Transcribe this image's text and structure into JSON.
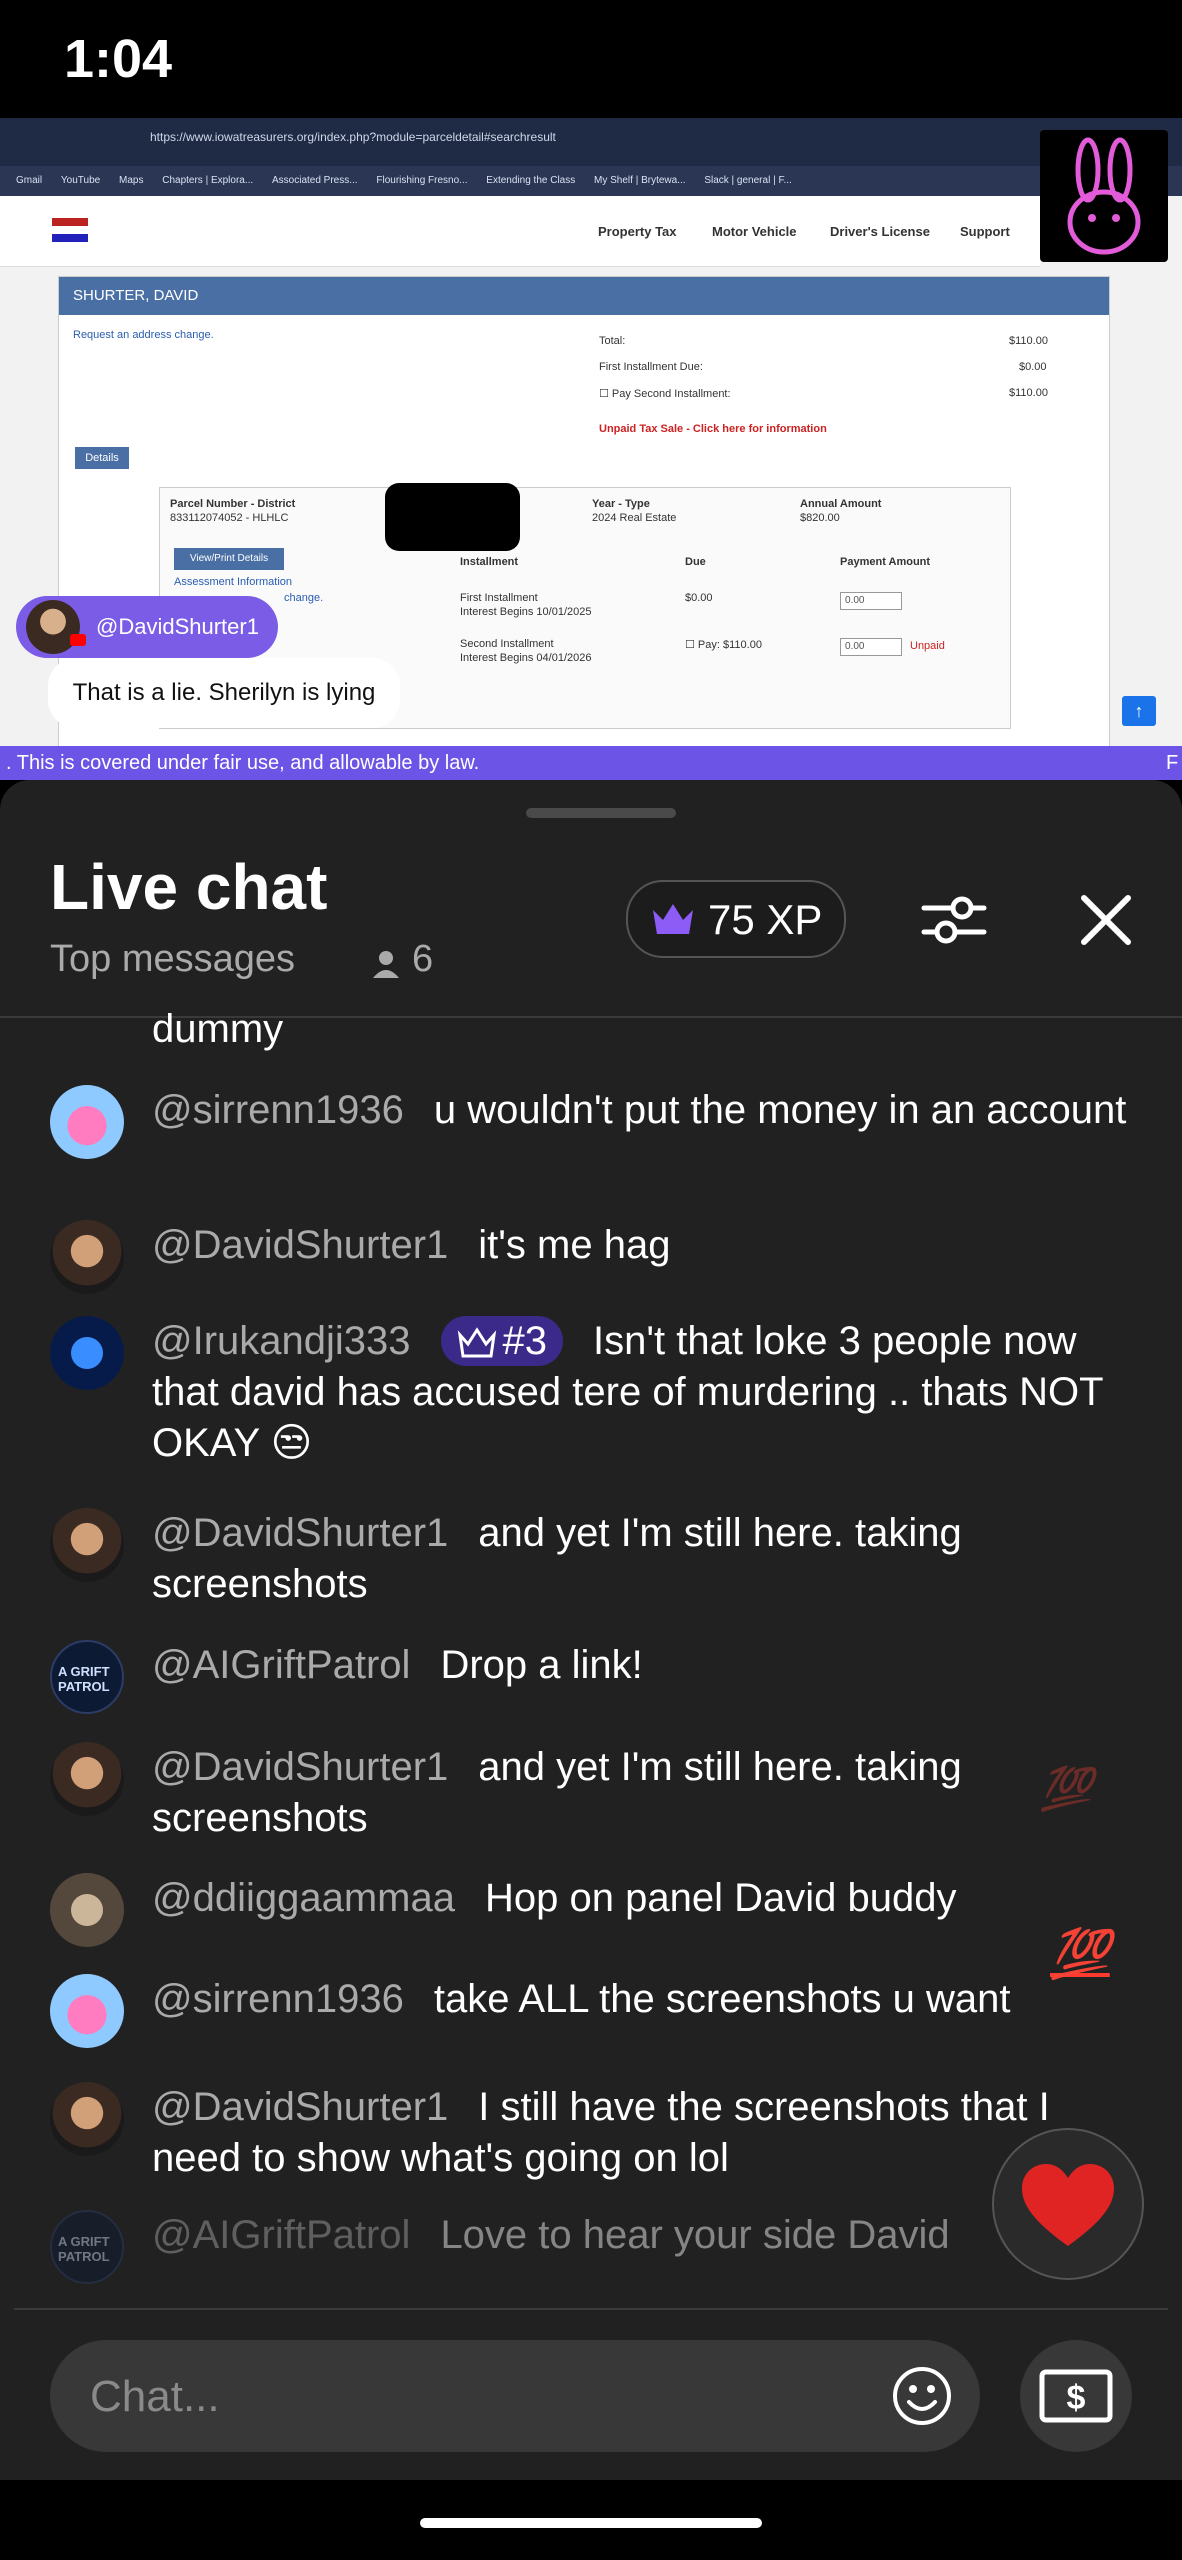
{
  "status_bar": {
    "time": "1:04"
  },
  "video": {
    "browser": {
      "url": "https://www.iowatreasurers.org/index.php?module=parceldetail#searchresult",
      "bookmarks": [
        "Gmail",
        "YouTube",
        "Maps",
        "Chapters | Explora...",
        "Associated Press...",
        "Flourishing Fresno...",
        "Extending the Class",
        "My Shelf | Brytewa...",
        "Slack | general | F..."
      ]
    },
    "site_nav": [
      "Property Tax",
      "Motor Vehicle",
      "Driver's License",
      "Support"
    ],
    "owner": "SHURTER, DAVID",
    "address_link": "Request an address change.",
    "total_label": "Total:",
    "total_value": "$110.00",
    "first_due_label": "First Installment Due:",
    "first_due_value": "$0.00",
    "pay_second_label": "Pay Second Installment:",
    "pay_second_value": "$110.00",
    "unpaid_notice": "Unpaid Tax Sale - Click here for information",
    "details_button": "Details",
    "parcel_header": "Parcel Number - District",
    "parcel_value": "833112074052 - HLHLC",
    "year_type_header": "Year - Type",
    "year_type_value": "2024 Real Estate",
    "annual_header": "Annual Amount",
    "annual_value": "$820.00",
    "view_print": "View/Print Details",
    "assessment_link": "Assessment Information",
    "change_link": "change.",
    "installment_header": "Installment",
    "due_header": "Due",
    "payment_header": "Payment Amount",
    "first_installment": "First Installment",
    "first_interest": "Interest Begins 10/01/2025",
    "first_due": "$0.00",
    "first_payment": "0.00",
    "second_installment": "Second Installment",
    "second_interest": "Interest Begins 04/01/2026",
    "second_pay_label": "Pay: $110.00",
    "second_payment": "0.00",
    "unpaid_tag": "Unpaid",
    "pinned_author": "@DavidShurter1",
    "pinned_message": "That is a lie. Sherilyn is lying",
    "ticker": ". This is covered under fair use, and allowable by law.",
    "ticker_right": "F"
  },
  "chat": {
    "title": "Live chat",
    "mode": "Top messages",
    "viewer_count": "6",
    "xp": "75 XP",
    "partial_top": "dummy",
    "messages": [
      {
        "author": "@sirrenn1936",
        "text": "u wouldn't put the money in an account"
      },
      {
        "author": "@DavidShurter1",
        "text": "it's me hag"
      },
      {
        "author": "@Irukandji333",
        "badge": "#3",
        "text": "Isn't that loke 3 people now that david has accused tere of murdering .. thats NOT OKAY 😒"
      },
      {
        "author": "@DavidShurter1",
        "text": "and yet I'm still here. taking screenshots"
      },
      {
        "author": "@AIGriftPatrol",
        "text": "Drop a link!"
      },
      {
        "author": "@DavidShurter1",
        "text": "and yet I'm still here. taking screenshots"
      },
      {
        "author": "@ddiiggaammaa",
        "text": "Hop on panel David buddy"
      },
      {
        "author": "@sirrenn1936",
        "text": "take ALL the screenshots u want"
      },
      {
        "author": "@DavidShurter1",
        "text": "I still have the screenshots that I need to show what's going on lol"
      },
      {
        "author": "@AIGriftPatrol",
        "text": "Love to hear your side David"
      }
    ],
    "avatar_labels": {
      "patrol": "A GRIFT PATROL"
    },
    "reaction_100": "💯",
    "input_placeholder": "Chat..."
  },
  "colors": {
    "accent_purple": "#6c55e6",
    "sheet_bg": "#212121",
    "badge_bg": "#3b2a8a",
    "heart": "#e02424"
  }
}
